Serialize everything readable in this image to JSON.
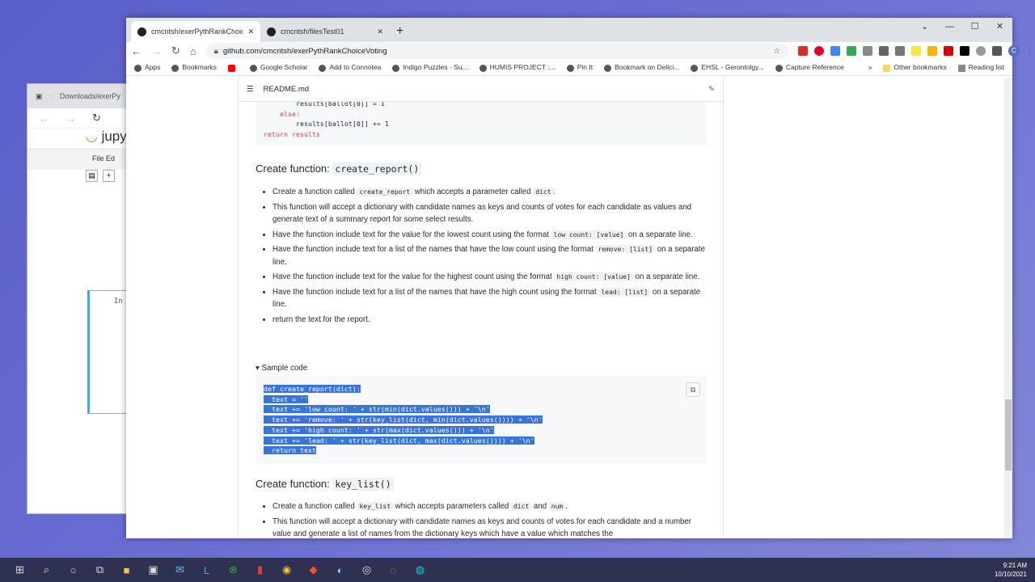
{
  "jupyter": {
    "tab": "Downloads/exerPy",
    "logo": "jupy",
    "menu": "File  Ed",
    "cell_prompt": "In"
  },
  "browser": {
    "tabs": [
      {
        "label": "cmcntsh/exerPythRankChoiceVoting",
        "active": true
      },
      {
        "label": "cmcntsh/filesTest01",
        "active": false
      }
    ],
    "url": "github.com/cmcntsh/exerPythRankChoiceVoting",
    "profile_initial": "C",
    "bookmarks": [
      "Apps",
      "Bookmarks",
      "",
      "Google Scholar",
      "Add to Connotea",
      "Indigo Puzzles - Su...",
      "HUMIS PROJECT :...",
      "Pin It",
      "Bookmark on Delici...",
      "EHSL - Gerontolgy...",
      "Capture Reference"
    ],
    "other_bookmarks": "Other bookmarks",
    "reading_list": "Reading list"
  },
  "readme": {
    "file": "README.md",
    "top_code": [
      "        results[ballot[0]] = 1",
      "    else:",
      "        results[ballot[0]] += 1",
      "return results"
    ],
    "h_report": {
      "text": "Create function: ",
      "code": "create_report()"
    },
    "report_bullets": [
      [
        {
          "t": "Create a function called "
        },
        {
          "c": "create_report"
        },
        {
          "t": " which accepts a parameter called "
        },
        {
          "c": "dict"
        },
        {
          "t": "."
        }
      ],
      [
        {
          "t": "This function will accept a dictionary with candidate names as keys and counts of votes for each candidate as values and generate text of a summary report for some select results."
        }
      ],
      [
        {
          "t": "Have the function include text for the value for the lowest count using the format "
        },
        {
          "c": "low count: [value]"
        },
        {
          "t": " on a separate line."
        }
      ],
      [
        {
          "t": "Have the function include text for a list of the names that have the low count using the format "
        },
        {
          "c": "remove: [list]"
        },
        {
          "t": " on a separate line."
        }
      ],
      [
        {
          "t": "Have the function include text for the value for the highest count using the format "
        },
        {
          "c": "high count: [value]"
        },
        {
          "t": " on a separate line."
        }
      ],
      [
        {
          "t": "Have the function include text for a list of the names that have the high count using the format "
        },
        {
          "c": "lead: [list]"
        },
        {
          "t": " on a separate line."
        }
      ],
      [
        {
          "t": "return the text for the report."
        }
      ]
    ],
    "sample_summary": "Sample code",
    "sample_code": [
      "def create_report(dict):",
      "  text = ''",
      "  text += 'low count: ' + str(min(dict.values())) + '\\n'",
      "  text += 'remove: ' + str(key_list(dict, min(dict.values()))) + '\\n'",
      "  text += 'high count: ' + str(max(dict.values())) + '\\n'",
      "  text += 'lead: ' + str(key_list(dict, max(dict.values()))) + '\\n'",
      "  return text"
    ],
    "h_keylist": {
      "text": "Create function: ",
      "code": "key_list()"
    },
    "keylist_bullets": [
      [
        {
          "t": "Create a function called "
        },
        {
          "c": "key_list"
        },
        {
          "t": " which accepts parameters called "
        },
        {
          "c": "dict"
        },
        {
          "t": " and "
        },
        {
          "c": "num"
        },
        {
          "t": "."
        }
      ],
      [
        {
          "t": "This function will accept a dictionary with candidate names as keys and counts of votes for each candidate and a number value and generate a list of names from the dictionary keys which have a value which matches the"
        }
      ]
    ]
  },
  "taskbar": {
    "time": "9:21 AM",
    "date": "10/10/2021"
  },
  "colors": {
    "selection": "#3875d7",
    "desktop": "#5a5ec9"
  }
}
